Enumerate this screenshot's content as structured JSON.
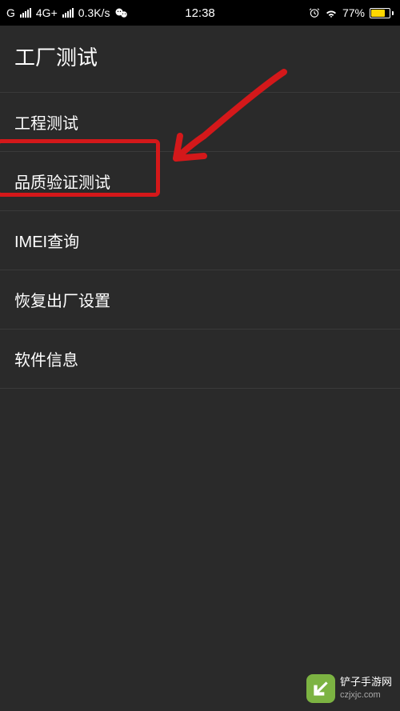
{
  "status_bar": {
    "network_type_left": "G",
    "network_speed_label": "4G+",
    "data_rate": "0.3K/s",
    "time": "12:38",
    "battery_percent": "77%"
  },
  "header": {
    "title": "工厂测试"
  },
  "menu": {
    "items": [
      {
        "label": "工程测试"
      },
      {
        "label": "品质验证测试"
      },
      {
        "label": "IMEI查询"
      },
      {
        "label": "恢复出厂设置"
      },
      {
        "label": "软件信息"
      }
    ]
  },
  "watermark": {
    "title": "铲子手游网",
    "url": "czjxjc.com"
  }
}
